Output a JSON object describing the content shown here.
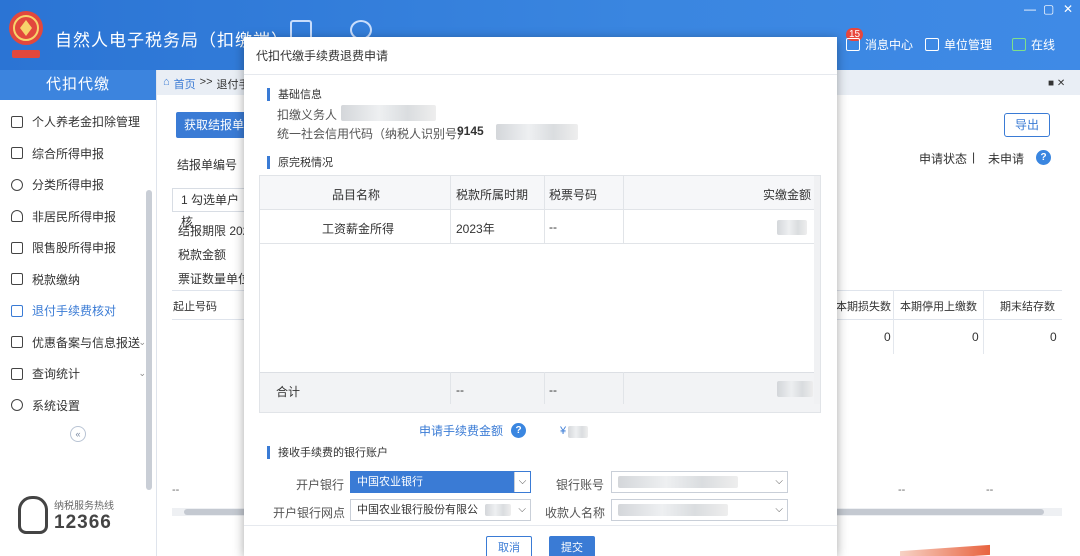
{
  "app": {
    "title": "自然人电子税务局（扣缴端）",
    "window_controls": [
      "—",
      "▢",
      "✕"
    ],
    "header_items": [
      {
        "label": "消息中心",
        "icon": "mail-icon",
        "badge": "15"
      },
      {
        "label": "单位管理",
        "icon": "building-icon"
      },
      {
        "label": "在线",
        "icon": "online-status-icon"
      }
    ]
  },
  "sidebar": {
    "title": "代扣代缴",
    "items": [
      {
        "label": "个人养老金扣除管理",
        "icon": "document-icon"
      },
      {
        "label": "综合所得申报",
        "icon": "layers-icon"
      },
      {
        "label": "分类所得申报",
        "icon": "pie-icon"
      },
      {
        "label": "非居民所得申报",
        "icon": "user-icon"
      },
      {
        "label": "限售股所得申报",
        "icon": "bar-chart-icon"
      },
      {
        "label": "税款缴纳",
        "icon": "folder-icon"
      },
      {
        "label": "退付手续费核对",
        "icon": "checklist-icon",
        "active": true
      },
      {
        "label": "优惠备案与信息报送",
        "icon": "copy-icon",
        "expandable": true
      },
      {
        "label": "查询统计",
        "icon": "search-list-icon",
        "expandable": true
      },
      {
        "label": "系统设置",
        "icon": "gear-icon"
      }
    ],
    "collapse_symbol": "«",
    "hotline_label": "纳税服务热线",
    "hotline_number": "12366"
  },
  "background": {
    "breadcrumb": [
      "首页",
      ">>",
      "退付手"
    ],
    "fetch_button": "获取结报单",
    "export_button": "导出",
    "status_label": "申请状态",
    "status_sep": "|",
    "status_value": "未申请",
    "help": "?",
    "labels": {
      "report_no": "结报单编号",
      "select_row": "1 勾选单户核",
      "period": "结报期限  202",
      "tax_amount": "税款金额",
      "ticket_unit": "票证数量单位"
    },
    "table_headers": [
      "起止号码",
      "本期损失数",
      "本期停用上缴数",
      "期末结存数"
    ],
    "table_values": [
      "0",
      "0",
      "0"
    ],
    "footer_dashes": [
      "--",
      "--",
      "--"
    ]
  },
  "modal": {
    "title": "代扣代缴手续费退费申请",
    "basic_section": "基础信息",
    "withholder_label": "扣缴义务人",
    "credit_code_label": "统一社会信用代码（纳税人识别号）",
    "credit_code_prefix": "9145",
    "original_section": "原完税情况",
    "table": {
      "headers": [
        "品目名称",
        "税款所属时期",
        "税票号码",
        "实缴金额"
      ],
      "rows": [
        {
          "item": "工资薪金所得",
          "period": "2023年",
          "ticket": "--"
        }
      ],
      "footer": {
        "label": "合计",
        "period": "--",
        "ticket": "--"
      }
    },
    "fee_label": "申请手续费金额",
    "fee_help": "?",
    "fee_currency": "¥",
    "bank_section": "接收手续费的银行账户",
    "bank_label": "开户银行",
    "bank_value": "中国农业银行",
    "account_label": "银行账号",
    "branch_label": "开户银行网点",
    "branch_value": "中国农业银行股份有限公",
    "payee_label": "收款人名称",
    "dropdown_arrow": "⌵",
    "cancel_button": "取消",
    "submit_button": "提交"
  },
  "colors": {
    "header": "#2b74d4",
    "accent": "#3a7bd5",
    "badge": "#e8463c"
  }
}
